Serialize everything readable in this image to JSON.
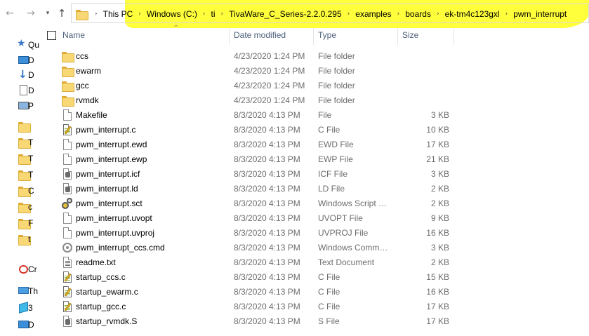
{
  "breadcrumb": [
    "This PC",
    "Windows (C:)",
    "ti",
    "TivaWare_C_Series-2.2.0.295",
    "examples",
    "boards",
    "ek-tm4c123gxl",
    "pwm_interrupt"
  ],
  "columns": {
    "name": "Name",
    "date": "Date modified",
    "type": "Type",
    "size": "Size"
  },
  "nav": [
    {
      "label": "Qu",
      "icon": "star-icon"
    },
    {
      "label": "D",
      "icon": "desktop-icon"
    },
    {
      "label": "D",
      "icon": "downloads-icon"
    },
    {
      "label": "D",
      "icon": "documents-icon"
    },
    {
      "label": "P",
      "icon": "pictures-icon"
    },
    {
      "label": "",
      "icon": "folder-icon"
    },
    {
      "label": "T",
      "icon": "folder-icon"
    },
    {
      "label": "T",
      "icon": "folder-icon"
    },
    {
      "label": "T",
      "icon": "folder-icon"
    },
    {
      "label": "C",
      "icon": "folder-icon"
    },
    {
      "label": "c",
      "icon": "folder-icon"
    },
    {
      "label": "F",
      "icon": "folder-icon"
    },
    {
      "label": "t",
      "icon": "folder-icon"
    },
    {
      "label": "Cr",
      "icon": "creative-cloud-icon"
    },
    {
      "label": "Th",
      "icon": "this-pc-icon"
    },
    {
      "label": "3",
      "icon": "3d-objects-icon"
    },
    {
      "label": "D",
      "icon": "desktop-icon"
    }
  ],
  "files": [
    {
      "name": "ccs",
      "date": "4/23/2020 1:24 PM",
      "type": "File folder",
      "size": "",
      "icon": "folder"
    },
    {
      "name": "ewarm",
      "date": "4/23/2020 1:24 PM",
      "type": "File folder",
      "size": "",
      "icon": "folder"
    },
    {
      "name": "gcc",
      "date": "4/23/2020 1:24 PM",
      "type": "File folder",
      "size": "",
      "icon": "folder"
    },
    {
      "name": "rvmdk",
      "date": "4/23/2020 1:24 PM",
      "type": "File folder",
      "size": "",
      "icon": "folder"
    },
    {
      "name": "Makefile",
      "date": "8/3/2020 4:13 PM",
      "type": "File",
      "size": "3 KB",
      "icon": "file"
    },
    {
      "name": "pwm_interrupt.c",
      "date": "8/3/2020 4:13 PM",
      "type": "C File",
      "size": "10 KB",
      "icon": "c"
    },
    {
      "name": "pwm_interrupt.ewd",
      "date": "8/3/2020 4:13 PM",
      "type": "EWD File",
      "size": "17 KB",
      "icon": "file"
    },
    {
      "name": "pwm_interrupt.ewp",
      "date": "8/3/2020 4:13 PM",
      "type": "EWP File",
      "size": "21 KB",
      "icon": "file"
    },
    {
      "name": "pwm_interrupt.icf",
      "date": "8/3/2020 4:13 PM",
      "type": "ICF File",
      "size": "3 KB",
      "icon": "ld"
    },
    {
      "name": "pwm_interrupt.ld",
      "date": "8/3/2020 4:13 PM",
      "type": "LD File",
      "size": "2 KB",
      "icon": "ld"
    },
    {
      "name": "pwm_interrupt.sct",
      "date": "8/3/2020 4:13 PM",
      "type": "Windows Script C...",
      "size": "2 KB",
      "icon": "script"
    },
    {
      "name": "pwm_interrupt.uvopt",
      "date": "8/3/2020 4:13 PM",
      "type": "UVOPT File",
      "size": "9 KB",
      "icon": "file"
    },
    {
      "name": "pwm_interrupt.uvproj",
      "date": "8/3/2020 4:13 PM",
      "type": "UVPROJ File",
      "size": "16 KB",
      "icon": "file"
    },
    {
      "name": "pwm_interrupt_ccs.cmd",
      "date": "8/3/2020 4:13 PM",
      "type": "Windows Comma...",
      "size": "3 KB",
      "icon": "cmd"
    },
    {
      "name": "readme.txt",
      "date": "8/3/2020 4:13 PM",
      "type": "Text Document",
      "size": "2 KB",
      "icon": "txt"
    },
    {
      "name": "startup_ccs.c",
      "date": "8/3/2020 4:13 PM",
      "type": "C File",
      "size": "15 KB",
      "icon": "c"
    },
    {
      "name": "startup_ewarm.c",
      "date": "8/3/2020 4:13 PM",
      "type": "C File",
      "size": "16 KB",
      "icon": "c"
    },
    {
      "name": "startup_gcc.c",
      "date": "8/3/2020 4:13 PM",
      "type": "C File",
      "size": "17 KB",
      "icon": "c"
    },
    {
      "name": "startup_rvmdk.S",
      "date": "8/3/2020 4:13 PM",
      "type": "S File",
      "size": "17 KB",
      "icon": "ld"
    }
  ]
}
